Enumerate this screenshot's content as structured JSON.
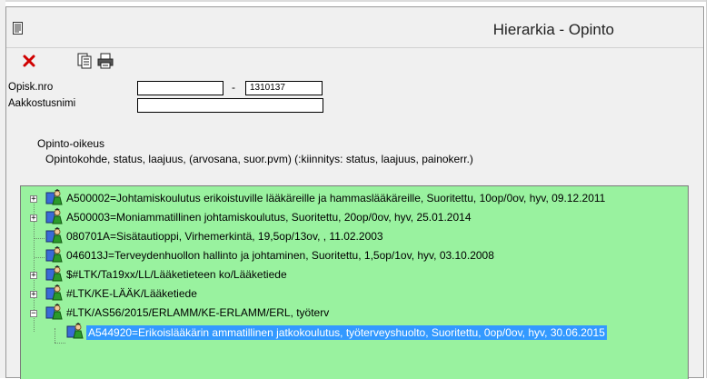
{
  "window": {
    "title": "Hierarkia - Opinto"
  },
  "toolbar": {
    "close_icon": "close-icon",
    "document_icon": "document-icon",
    "print_icon": "print-icon"
  },
  "form": {
    "student_number_label": "Opisk.nro",
    "student_number_part1": "",
    "separator": "-",
    "student_number_part2": "1310137",
    "sort_name_label": "Aakkostusnimi",
    "sort_name_value": "",
    "section_title": "Opinto-oikeus",
    "section_subtitle": "Opintokohde, status, laajuus, (arvosana, suor.pvm) (:kiinnitys: status, laajuus, painokerr.)"
  },
  "tree": {
    "background": "#99f29f",
    "selected_color": "#3399ff",
    "items": [
      {
        "text": "A500002=Johtamiskoulutus erikoistuville lääkäreille ja hammaslääkäreille, Suoritettu, 10op/0ov, hyv, 09.12.2011",
        "expander": "+"
      },
      {
        "text": "A500003=Moniammatillinen johtamiskoulutus, Suoritettu, 20op/0ov, hyv, 25.01.2014",
        "expander": "+"
      },
      {
        "text": "080701A=Sisätautioppi, Virhemerkintä, 19,5op/13ov, , 11.02.2003",
        "expander": ""
      },
      {
        "text": "046013J=Terveydenhuollon hallinto ja johtaminen, Suoritettu, 1,5op/1ov, hyv, 03.10.2008",
        "expander": ""
      },
      {
        "text": "$#LTK/Ta19xx/LL/Lääketieteen ko/Lääketiede",
        "expander": "+"
      },
      {
        "text": "#LTK/KE-LÄÄK/Lääketiede",
        "expander": "+"
      },
      {
        "text": "#LTK/AS56/2015/ERLAMM/KE-ERLAMM/ERL, työterv",
        "expander": "−"
      },
      {
        "text": "A544920=Erikoislääkärin ammatillinen jatkokoulutus, työterveyshuolto, Suoritettu, 0op/0ov, hyv, 30.06.2015",
        "expander": ""
      }
    ]
  }
}
